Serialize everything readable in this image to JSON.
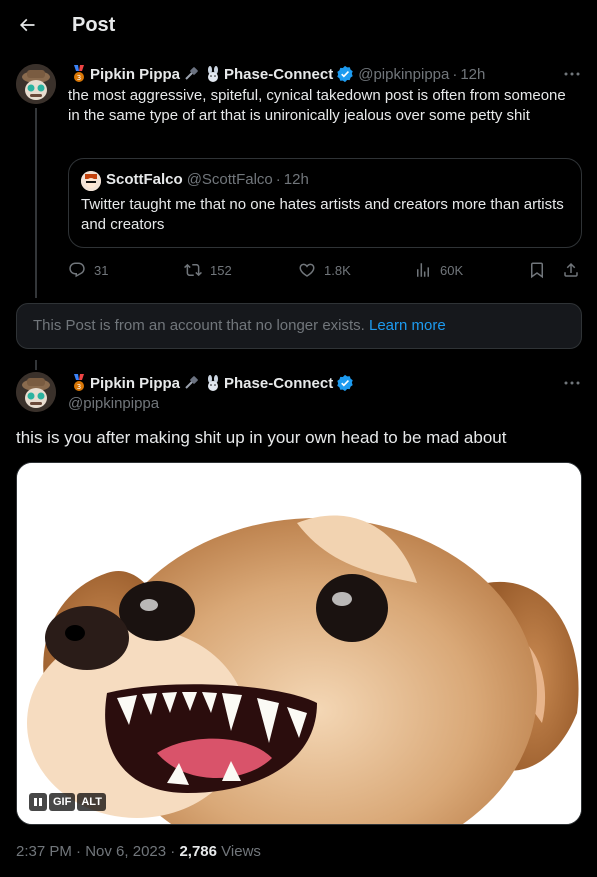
{
  "header": {
    "title": "Post",
    "back_icon": "arrow-left-icon"
  },
  "parent_post": {
    "display_name": "Pipkin Pippa",
    "affiliation": "Phase-Connect",
    "handle": "@pipkinpippa",
    "separator": "·",
    "time": "12h",
    "text": "the most aggressive, spiteful, cynical takedown post is often from someone in the same type of art that is unironically jealous over some petty shit",
    "quote": {
      "display_name": "ScottFalco",
      "handle": "@ScottFalco",
      "separator": "·",
      "time": "12h",
      "text": "Twitter taught me that no one hates artists and creators more than artists and creators"
    },
    "actions": {
      "replies": "31",
      "reposts": "152",
      "likes": "1.8K",
      "views": "60K"
    }
  },
  "notice": {
    "text": "This Post is from an account that no longer exists.",
    "link": "Learn more"
  },
  "main_post": {
    "display_name": "Pipkin Pippa",
    "affiliation": "Phase-Connect",
    "handle": "@pipkinpippa",
    "text": "this is you after making shit up in your own head to be mad about",
    "media": {
      "gif_label": "GIF",
      "alt_label": "ALT",
      "pause_icon": "pause-icon"
    },
    "meta": {
      "time": "2:37 PM",
      "separator1": "·",
      "date": "Nov 6, 2023",
      "separator2": "·",
      "views_count": "2,786",
      "views_label": "Views"
    }
  },
  "colors": {
    "accent": "#1d9bf0",
    "muted": "#71767b",
    "text": "#e7e9ea",
    "background": "#000000",
    "border": "#2f3336"
  }
}
